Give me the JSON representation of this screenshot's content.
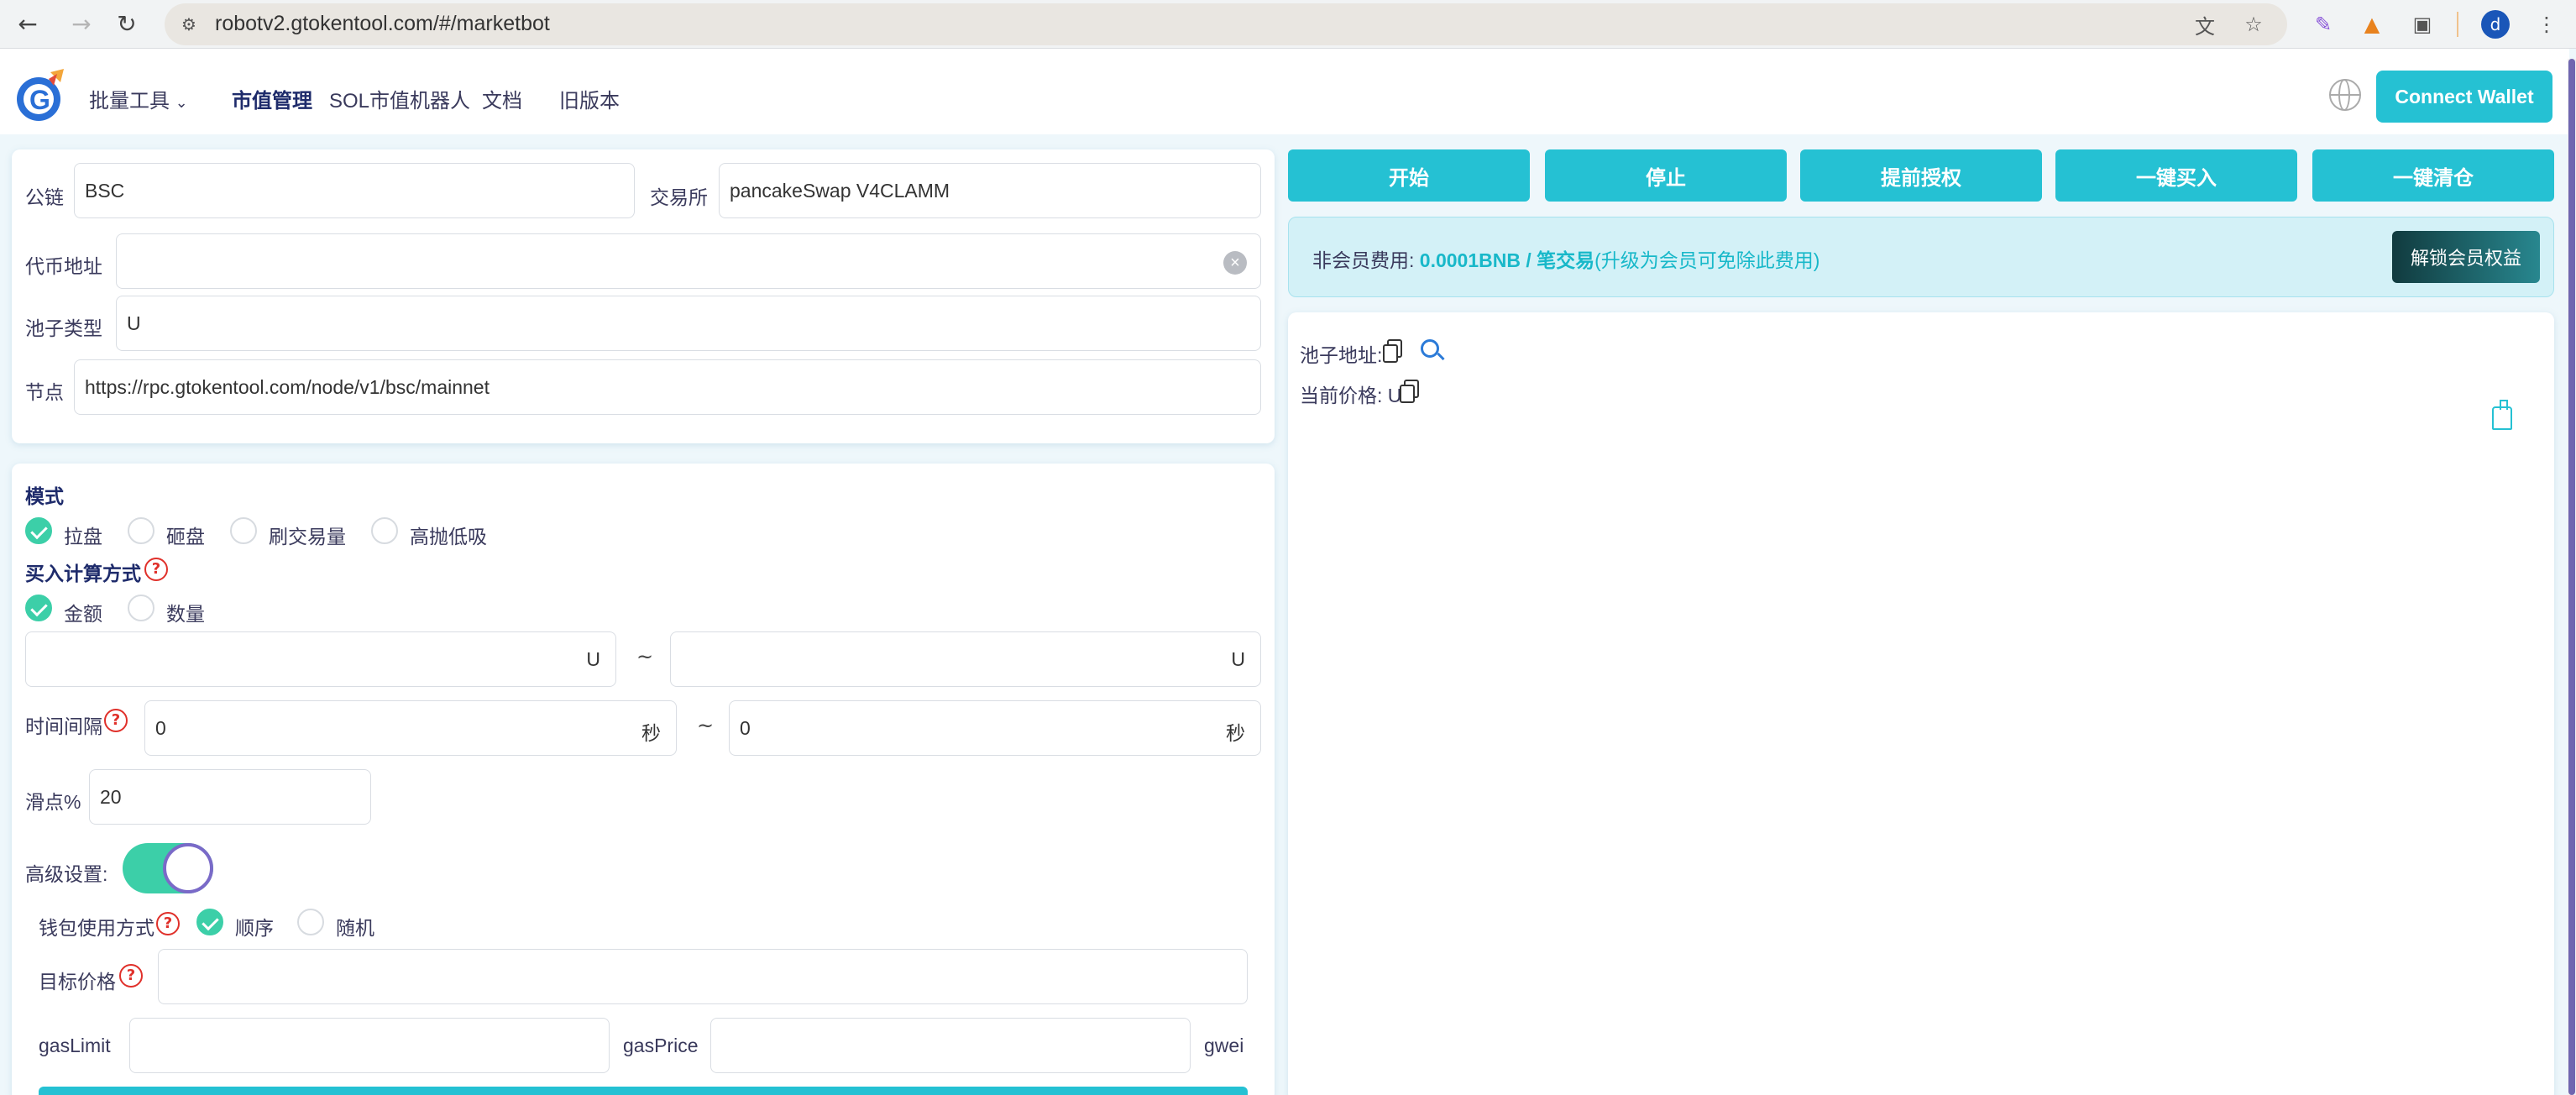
{
  "browser": {
    "url": "robotv2.gtokentool.com/#/marketbot",
    "profile_initial": "d"
  },
  "nav": {
    "batch_tools": "批量工具",
    "market_cap_management": "市值管理",
    "sol_bot": "SOL市值机器人",
    "docs": "文档",
    "old_version": "旧版本",
    "connect_wallet": "Connect Wallet"
  },
  "config": {
    "chain_label": "公链",
    "chain_value": "BSC",
    "exchange_label": "交易所",
    "exchange_value": "pancakeSwap V4CLAMM",
    "token_address_label": "代币地址",
    "token_address_value": "",
    "pool_type_label": "池子类型",
    "pool_type_value": "U",
    "node_label": "节点",
    "node_value": "https://rpc.gtokentool.com/node/v1/bsc/mainnet"
  },
  "mode": {
    "title": "模式",
    "options": [
      {
        "label": "拉盘",
        "checked": true
      },
      {
        "label": "砸盘",
        "checked": false
      },
      {
        "label": "刷交易量",
        "checked": false
      },
      {
        "label": "高抛低吸",
        "checked": false
      }
    ]
  },
  "buy_calc": {
    "title": "买入计算方式",
    "options": [
      {
        "label": "金额",
        "checked": true
      },
      {
        "label": "数量",
        "checked": false
      }
    ],
    "min_value": "",
    "max_value": "",
    "unit": "U",
    "range_sep": "~"
  },
  "interval": {
    "label": "时间间隔",
    "min_value": "0",
    "max_value": "0",
    "unit": "秒",
    "range_sep": "~"
  },
  "slippage": {
    "label": "滑点%",
    "value": "20"
  },
  "advanced": {
    "label": "高级设置:",
    "enabled": true,
    "wallet_mode_label": "钱包使用方式",
    "wallet_modes": [
      {
        "label": "顺序",
        "checked": true
      },
      {
        "label": "随机",
        "checked": false
      }
    ],
    "target_price_label": "目标价格",
    "target_price_value": "",
    "gas_limit_label": "gasLimit",
    "gas_limit_value": "",
    "gas_price_label": "gasPrice",
    "gas_price_value": "",
    "gas_unit": "gwei"
  },
  "actions": {
    "start": "开始",
    "stop": "停止",
    "pre_approve": "提前授权",
    "one_click_buy": "一键买入",
    "one_click_sell_all": "一键清仓"
  },
  "fee": {
    "label": "非会员费用:",
    "amount": "0.0001BNB / 笔交易",
    "note": "(升级为会员可免除此费用)",
    "unlock": "解锁会员权益"
  },
  "info": {
    "pool_address_label": "池子地址:",
    "current_price_label": "当前价格: U"
  },
  "colors": {
    "accent": "#25c1d3",
    "check_on": "#3ccfa8",
    "help_red": "#e0302a"
  }
}
